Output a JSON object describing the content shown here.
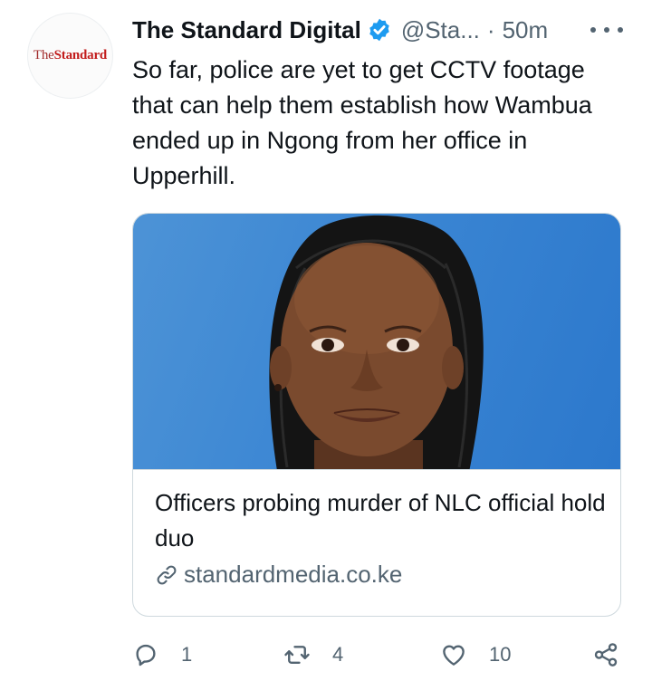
{
  "tweet": {
    "author": {
      "display_name": "The Standard Digital",
      "handle": "@Sta...",
      "verified": true,
      "avatar_logo": {
        "prefix": "The",
        "word": "Standard"
      }
    },
    "separator": "·",
    "time": "50m",
    "more_icon": "more-horizontal-icon",
    "text": "So far, police are yet to get CCTV footage that can help them establish how Wambua ended up in Ngong from her office in Upperhill.",
    "card": {
      "title": "Officers probing murder of NLC official hold duo",
      "domain": "standardmedia.co.ke",
      "link_icon": "link-icon",
      "image_background": "#3b86d3"
    },
    "actions": {
      "reply": {
        "icon": "reply-icon",
        "count": "1"
      },
      "retweet": {
        "icon": "retweet-icon",
        "count": "4"
      },
      "like": {
        "icon": "heart-icon",
        "count": "10"
      },
      "share": {
        "icon": "share-icon",
        "count": ""
      }
    }
  },
  "colors": {
    "text_primary": "#0f1419",
    "text_secondary": "#536471",
    "verified_blue": "#1d9bf0",
    "border": "#cfd9de",
    "brand_red": "#c21c1c"
  }
}
